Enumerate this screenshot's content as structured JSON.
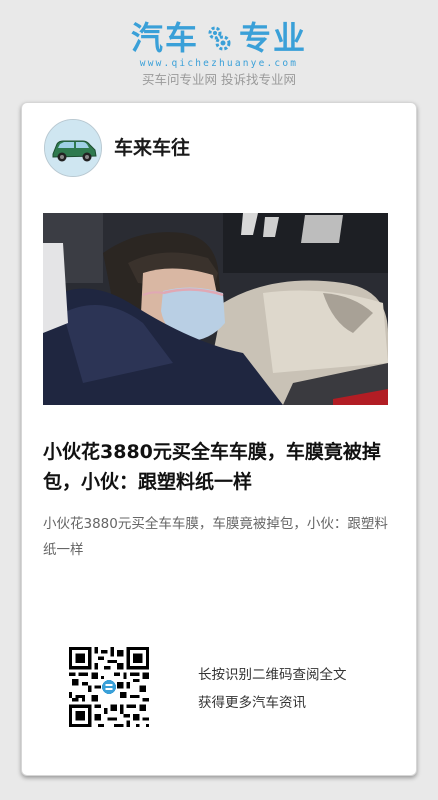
{
  "brand": {
    "name_left": "汽车",
    "name_right": "专业",
    "url": "www.qichezhuanye.com",
    "slogan": "买车问专业网 投诉找专业网",
    "color": "#3aa0d8"
  },
  "post": {
    "author": "车来车往",
    "title": "小伙花3880元买全车车膜，车膜竟被掉包，小伙：跟塑料纸一样",
    "description": "小伙花3880元买全车车膜，车膜竟被掉包，小伙：跟塑料纸一样"
  },
  "qr": {
    "line1": "长按识别二维码查阅全文",
    "line2": "获得更多汽车资讯"
  }
}
